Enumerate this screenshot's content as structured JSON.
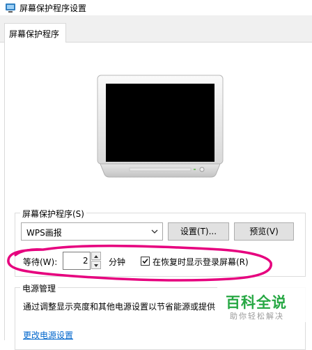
{
  "window": {
    "title": "屏幕保护程序设置"
  },
  "tabs": [
    {
      "label": "屏幕保护程序"
    }
  ],
  "screensaver": {
    "group_label": "屏幕保护程序(S)",
    "selected": "WPS画报",
    "settings_button": "设置(T)...",
    "preview_button": "预览(V)",
    "wait_label": "等待(W):",
    "wait_value": "2",
    "minutes_label": "分钟",
    "resume_checkbox_label": "在恢复时显示登录屏幕(R)",
    "resume_checked": true
  },
  "power": {
    "group_label": "电源管理",
    "description": "通过调整显示亮度和其他电源设置以节省能源或提供",
    "link": "更改电源设置"
  },
  "watermark": {
    "main": "百科全说",
    "sub": "助你轻松解决"
  },
  "colors": {
    "annotation": "#e6007e",
    "link": "#0066cc",
    "watermark_green": "#27a844"
  },
  "icons": [
    "screensaver-app-icon",
    "monitor-preview",
    "chevron-down-icon",
    "spin-up-icon",
    "spin-down-icon",
    "checkmark-icon"
  ]
}
